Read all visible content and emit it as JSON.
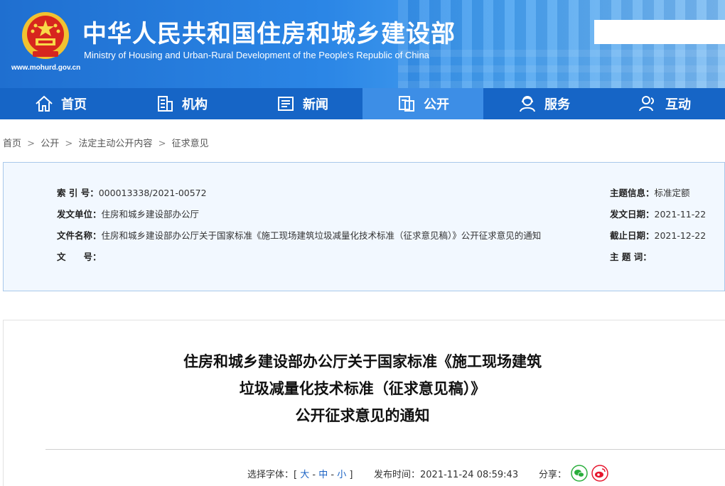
{
  "header": {
    "title": "中华人民共和国住房和城乡建设部",
    "subtitle": "Ministry of Housing and Urban-Rural Development of the People's Republic of China",
    "url": "www.mohurd.gov.cn"
  },
  "nav": {
    "items": [
      {
        "label": "首页",
        "icon": "home-icon"
      },
      {
        "label": "机构",
        "icon": "building-icon"
      },
      {
        "label": "新闻",
        "icon": "news-icon"
      },
      {
        "label": "公开",
        "icon": "open-icon",
        "active": true
      },
      {
        "label": "服务",
        "icon": "service-icon"
      },
      {
        "label": "互动",
        "icon": "interact-icon"
      }
    ]
  },
  "breadcrumb": [
    "首页",
    "公开",
    "法定主动公开内容",
    "征求意见"
  ],
  "info": {
    "index_label": "索 引 号：",
    "index_value": "000013338/2021-00572",
    "issuer_label": "发文单位：",
    "issuer_value": "住房和城乡建设部办公厅",
    "filename_label": "文件名称：",
    "filename_value": "住房和城乡建设部办公厅关于国家标准《施工现场建筑垃圾减量化技术标准（征求意见稿）》公开征求意见的通知",
    "docno_label": "文　　号：",
    "docno_value": "",
    "topic_label": "主题信息：",
    "topic_value": "标准定额",
    "date_label": "发文日期：",
    "date_value": "2021-11-22",
    "deadline_label": "截止日期：",
    "deadline_value": "2021-12-22",
    "keyword_label": "主 题 词：",
    "keyword_value": ""
  },
  "article": {
    "title_line1": "住房和城乡建设部办公厅关于国家标准《施工现场建筑",
    "title_line2": "垃圾减量化技术标准（征求意见稿）》",
    "title_line3": "公开征求意见的通知",
    "font_label": "选择字体：[",
    "font_large": "大",
    "font_medium": "中",
    "font_small": "小",
    "font_end": "]",
    "dash": "-",
    "publish_label": "发布时间：",
    "publish_value": "2021-11-24 08:59:43",
    "share_label": "分享："
  },
  "colors": {
    "nav_bg": "#1665c6",
    "nav_active": "#3d8ee6",
    "wechat": "#2aae3c",
    "weibo": "#e6162d"
  }
}
